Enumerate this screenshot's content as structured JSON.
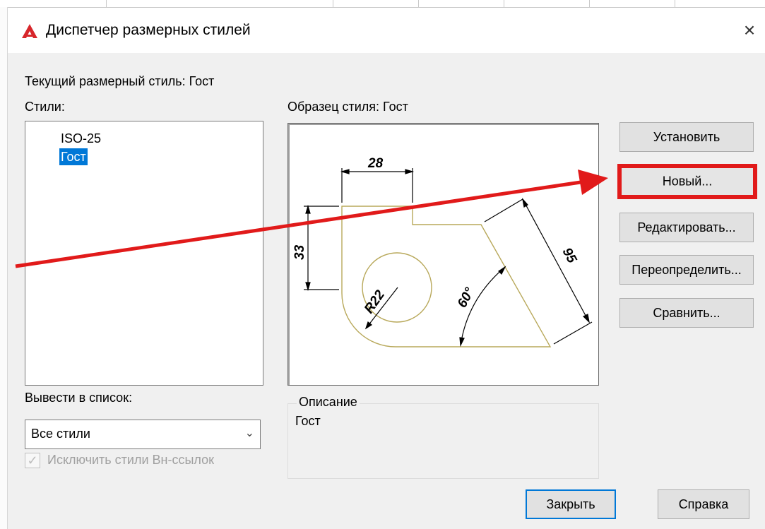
{
  "dialog": {
    "title": "Диспетчер размерных стилей",
    "close_glyph": "×"
  },
  "current_style_label": "Текущий размерный стиль: Гост",
  "styles": {
    "label": "Стили:",
    "items": [
      {
        "label": "ISO-25",
        "selected": false
      },
      {
        "label": "Гост",
        "selected": true
      }
    ]
  },
  "preview": {
    "label": "Образец стиля: Гост",
    "dim_28": "28",
    "dim_33": "33",
    "dim_95": "95",
    "dim_r22": "R22",
    "dim_60": "60°"
  },
  "buttons": {
    "set": "Установить",
    "new": "Новый...",
    "edit": "Редактировать...",
    "override": "Переопределить...",
    "compare": "Сравнить...",
    "close": "Закрыть",
    "help": "Справка"
  },
  "list_filter": {
    "label": "Вывести в список:",
    "value": "Все стили",
    "exclude_xref_label": "Исключить стили Вн-ссылок",
    "exclude_xref_checked": true
  },
  "description": {
    "label": "Описание",
    "text": "Гост"
  },
  "colors": {
    "accent": "#0078d7",
    "annotation_red": "#e11a1a",
    "geometry": "#b8a85a",
    "app_icon": "#d7262b"
  },
  "icons": [
    "autocad-app-icon",
    "close-icon",
    "chevron-down-icon",
    "checkbox-check-icon"
  ]
}
